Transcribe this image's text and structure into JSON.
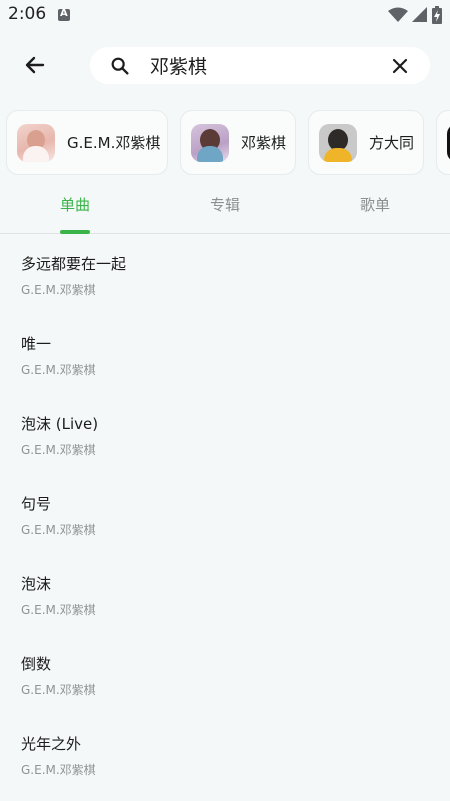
{
  "status_bar": {
    "time": "2:06"
  },
  "search": {
    "query": "邓紫棋"
  },
  "artists": [
    {
      "name": "G.E.M.邓紫棋"
    },
    {
      "name": "邓紫棋"
    },
    {
      "name": "方大同"
    },
    {
      "name": ""
    }
  ],
  "tabs": [
    {
      "label": "单曲",
      "active": true
    },
    {
      "label": "专辑",
      "active": false
    },
    {
      "label": "歌单",
      "active": false
    }
  ],
  "songs": [
    {
      "title": "多远都要在一起",
      "artist": "G.E.M.邓紫棋"
    },
    {
      "title": "唯一",
      "artist": "G.E.M.邓紫棋"
    },
    {
      "title": "泡沫 (Live)",
      "artist": "G.E.M.邓紫棋"
    },
    {
      "title": "句号",
      "artist": "G.E.M.邓紫棋"
    },
    {
      "title": "泡沫",
      "artist": "G.E.M.邓紫棋"
    },
    {
      "title": "倒数",
      "artist": "G.E.M.邓紫棋"
    },
    {
      "title": "光年之外",
      "artist": "G.E.M.邓紫棋"
    }
  ],
  "colors": {
    "accent": "#3bb54a",
    "background": "#f5f8f8"
  },
  "icons": [
    "back-arrow-icon",
    "search-icon",
    "clear-icon",
    "wifi-icon",
    "signal-icon",
    "battery-charging-icon"
  ]
}
